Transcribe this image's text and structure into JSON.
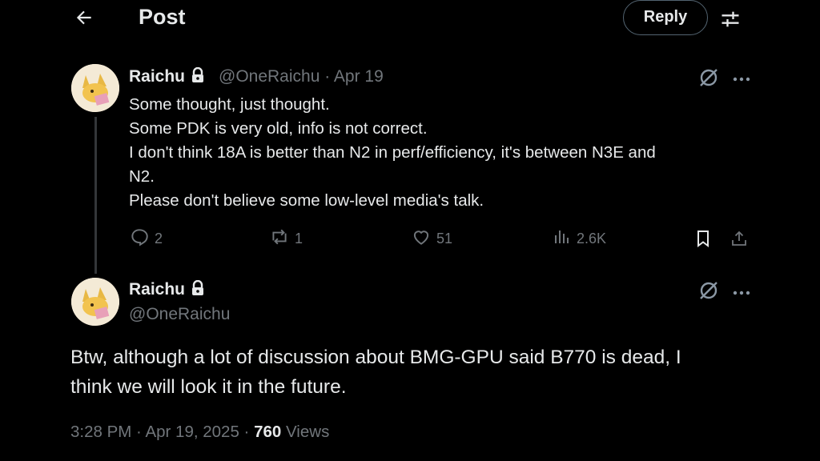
{
  "header": {
    "title": "Post",
    "reply_label": "Reply"
  },
  "parent_post": {
    "author_name": "Raichu",
    "author_handle": "@OneRaichu",
    "date": "Apr 19",
    "lines": [
      "Some thought, just thought.",
      "Some PDK is very old, info is not correct.",
      "I don't think 18A is better than N2 in perf/efficiency, it's between N3E and",
      "N2.",
      "Please don't believe some low-level media's talk."
    ],
    "stats": {
      "replies": "2",
      "reposts": "1",
      "likes": "51",
      "views": "2.6K"
    }
  },
  "main_post": {
    "author_name": "Raichu",
    "author_handle": "@OneRaichu",
    "lines": [
      "Btw, although a lot of discussion about BMG-GPU said B770 is dead, I",
      "think we will look it in the future."
    ],
    "time": "3:28 PM",
    "date": "Apr 19, 2025",
    "views_count": "760",
    "views_label": "Views"
  },
  "icons": [
    "back-arrow-icon",
    "settings-sliders-icon",
    "lock-icon",
    "grok-icon",
    "more-icon",
    "reply-icon",
    "repost-icon",
    "like-icon",
    "views-icon",
    "bookmark-icon",
    "share-icon"
  ]
}
